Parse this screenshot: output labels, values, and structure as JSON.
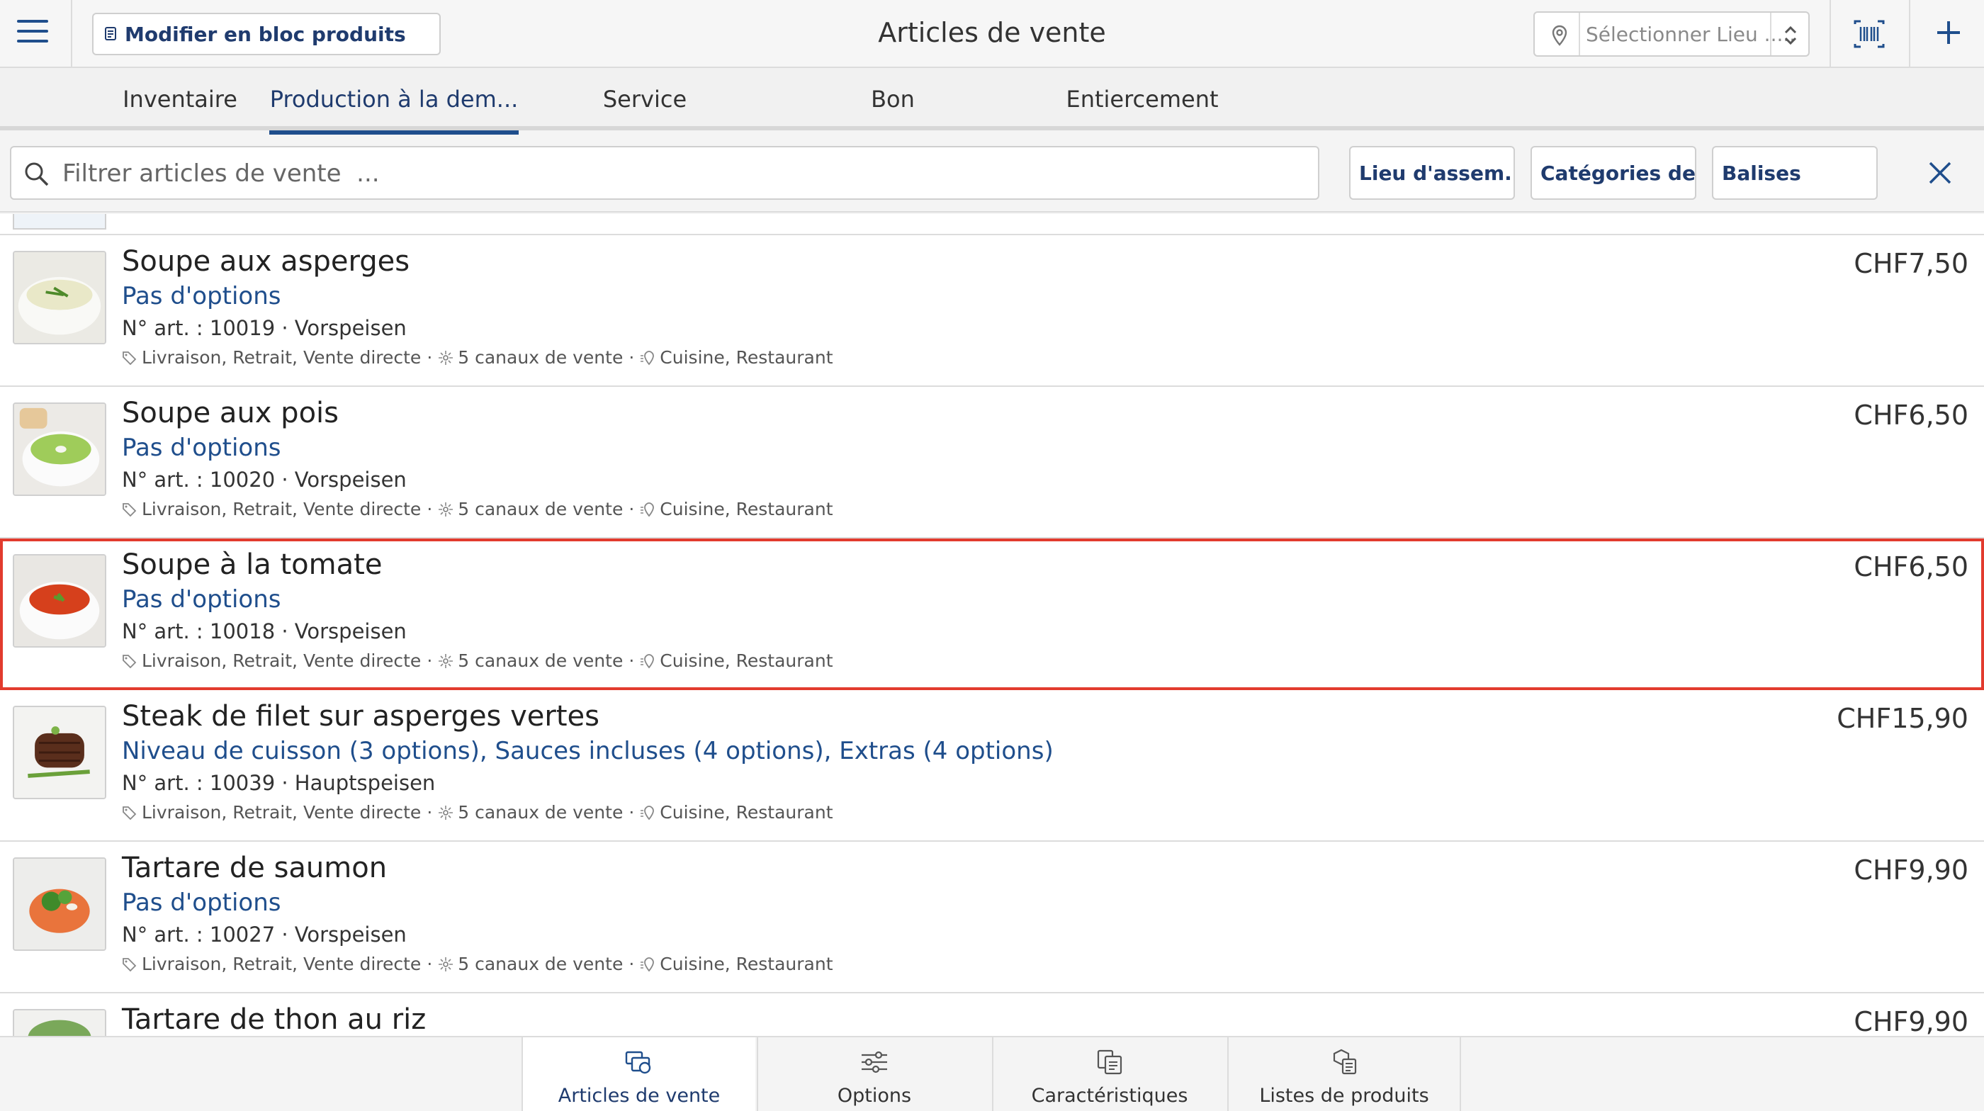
{
  "header": {
    "menu_icon": "hamburger-icon",
    "bulk_edit_label": "Modifier en bloc produits",
    "title": "Articles de vente",
    "location_placeholder": "Sélectionner Lieu .....",
    "barcode_icon": "barcode-icon",
    "add_icon": "plus-icon"
  },
  "tabs": [
    {
      "label": "Inventaire",
      "active": false
    },
    {
      "label": "Production à la dem...",
      "active": true
    },
    {
      "label": "Service",
      "active": false
    },
    {
      "label": "Bon",
      "active": false
    },
    {
      "label": "Entiercement",
      "active": false
    }
  ],
  "filter": {
    "search_placeholder": "Filtrer articles de vente  ...",
    "buttons": [
      "Lieu d'assem...",
      "Catégories de...",
      "Balises"
    ],
    "clear_icon": "close-icon"
  },
  "items": [
    {
      "name": "Soupe aux asperges",
      "options": "Pas d'options",
      "meta": "N° art. : 10019 · Vorspeisen",
      "channels": "Livraison, Retrait, Vente directe",
      "count": "5 canaux de vente",
      "locations": "Cuisine, Restaurant",
      "price": "CHF7,50",
      "selected": false,
      "image": "asparagus-soup"
    },
    {
      "name": "Soupe aux pois",
      "options": "Pas d'options",
      "meta": "N° art. : 10020 · Vorspeisen",
      "channels": "Livraison, Retrait, Vente directe",
      "count": "5 canaux de vente",
      "locations": "Cuisine, Restaurant",
      "price": "CHF6,50",
      "selected": false,
      "image": "pea-soup"
    },
    {
      "name": "Soupe à la tomate",
      "options": "Pas d'options",
      "meta": "N° art. : 10018 · Vorspeisen",
      "channels": "Livraison, Retrait, Vente directe",
      "count": "5 canaux de vente",
      "locations": "Cuisine, Restaurant",
      "price": "CHF6,50",
      "selected": true,
      "image": "tomato-soup"
    },
    {
      "name": "Steak de filet sur asperges vertes",
      "options": "Niveau de cuisson (3 options), Sauces incluses (4 options), Extras (4 options)",
      "meta": "N° art. : 10039 · Hauptspeisen",
      "channels": "Livraison, Retrait, Vente directe",
      "count": "5 canaux de vente",
      "locations": "Cuisine, Restaurant",
      "price": "CHF15,90",
      "selected": false,
      "image": "steak"
    },
    {
      "name": "Tartare de saumon",
      "options": "Pas d'options",
      "meta": "N° art. : 10027 · Vorspeisen",
      "channels": "Livraison, Retrait, Vente directe",
      "count": "5 canaux de vente",
      "locations": "Cuisine, Restaurant",
      "price": "CHF9,90",
      "selected": false,
      "image": "salmon-tartare"
    },
    {
      "name": "Tartare de thon au riz",
      "price": "CHF9,90",
      "selected": false,
      "image": "tuna-tartare"
    }
  ],
  "bottom_nav": [
    {
      "label": "Articles de vente",
      "icon": "sale-items-icon",
      "active": true
    },
    {
      "label": "Options",
      "icon": "sliders-icon",
      "active": false
    },
    {
      "label": "Caractéristiques",
      "icon": "characteristics-icon",
      "active": false
    },
    {
      "label": "Listes de produits",
      "icon": "product-lists-icon",
      "active": false
    }
  ],
  "colors": {
    "accent": "#1f4e8c",
    "selection_border": "#e23b2e"
  }
}
